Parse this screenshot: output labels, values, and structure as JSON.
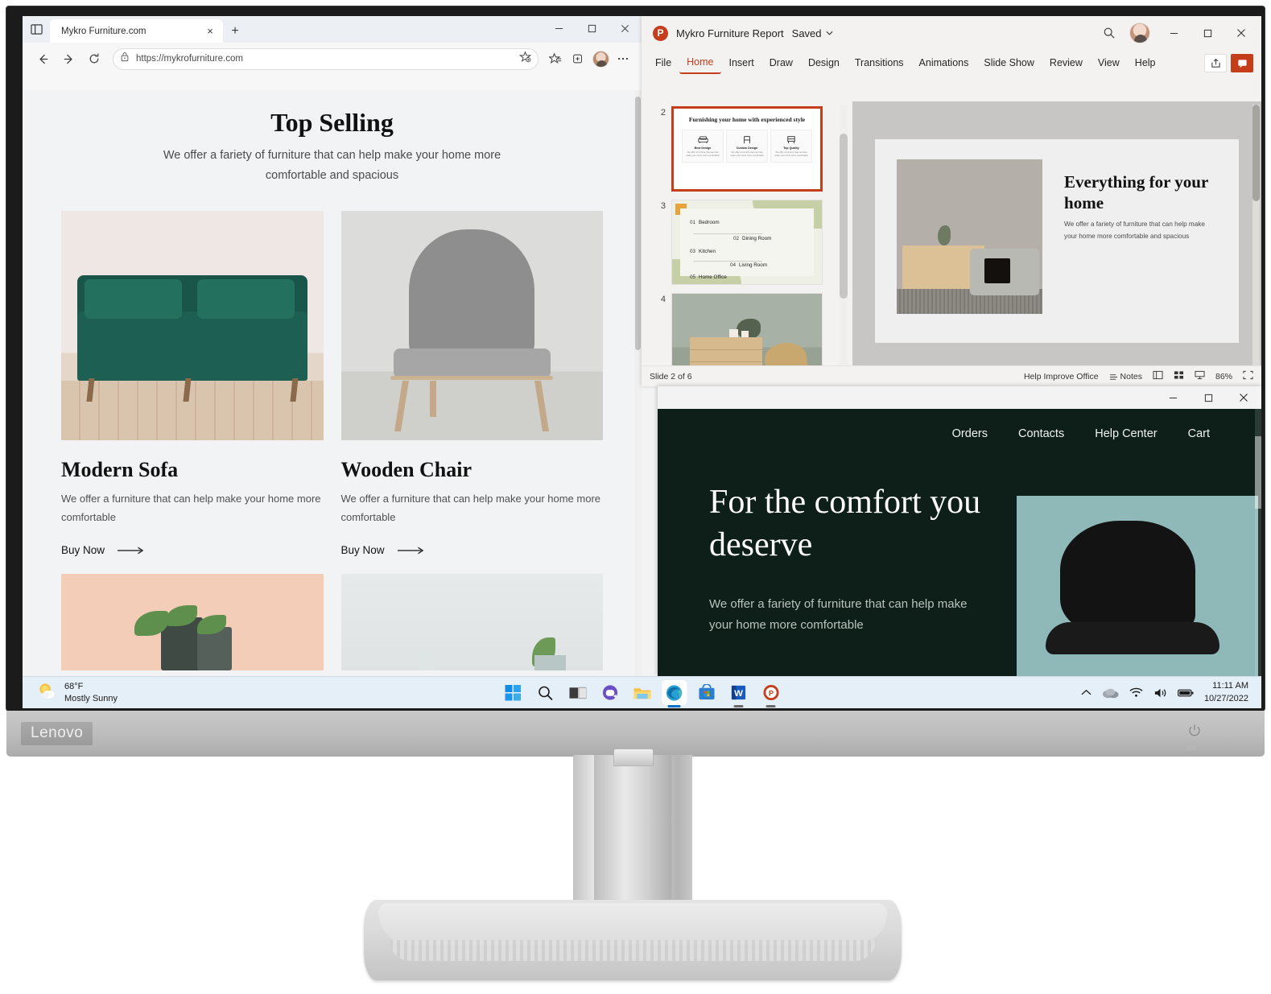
{
  "browser": {
    "tab": {
      "title": "Mykro Furniture.com",
      "close_label": "×"
    },
    "new_tab_label": "+",
    "url": "https://mykrofurniture.com",
    "window_controls": {
      "minimize": "—",
      "maximize": "□",
      "close": "✕"
    },
    "page": {
      "heading": "Top Selling",
      "subheading": "We offer a fariety of furniture that can help make your home more comfortable and spacious",
      "products": [
        {
          "name": "Modern Sofa",
          "description": "We offer a furniture that can help make your home more comfortable",
          "cta": "Buy Now"
        },
        {
          "name": "Wooden Chair",
          "description": "We offer a furniture that can help make your home more comfortable",
          "cta": "Buy Now"
        }
      ]
    }
  },
  "powerpoint": {
    "document_title": "Mykro Furniture Report",
    "save_status": "Saved",
    "ribbon_tabs": [
      "File",
      "Home",
      "Insert",
      "Draw",
      "Design",
      "Transitions",
      "Animations",
      "Slide Show",
      "Review",
      "View",
      "Help"
    ],
    "active_tab": "Home",
    "window_controls": {
      "minimize": "—",
      "maximize": "□",
      "close": "✕"
    },
    "slides": [
      {
        "number": "2",
        "selected": true,
        "title": "Furnishing your home with experienced style",
        "cards": [
          {
            "label": "Best Design",
            "body": "We offer a furniture that can help make your home more comfortable"
          },
          {
            "label": "Custom Design",
            "body": "We offer a furniture that can help make your home more comfortable"
          },
          {
            "label": "Top Quality",
            "body": "We offer a furniture that can help make your home more comfortable"
          }
        ]
      },
      {
        "number": "3",
        "selected": false,
        "items": [
          {
            "num": "01",
            "label": "Bedroom"
          },
          {
            "num": "02",
            "label": "Dining Room"
          },
          {
            "num": "03",
            "label": "Kitchen"
          },
          {
            "num": "04",
            "label": "Living Room"
          },
          {
            "num": "05",
            "label": "Home Office"
          }
        ]
      },
      {
        "number": "4",
        "selected": false
      }
    ],
    "current_slide": {
      "heading": "Everything for your home",
      "body": "We offer a fariety of furniture that can help make your home more comfortable and spacious"
    },
    "status": {
      "slide_counter": "Slide 2 of 6",
      "help_improve": "Help Improve Office",
      "notes": "Notes",
      "zoom": "86%"
    }
  },
  "site_window": {
    "window_controls": {
      "minimize": "—",
      "maximize": "□",
      "close": "✕"
    },
    "nav": [
      "Orders",
      "Contacts",
      "Help Center",
      "Cart"
    ],
    "hero_heading": "For the comfort you deserve",
    "hero_body": "We offer a fariety of furniture that can help make your home more comfortable"
  },
  "taskbar": {
    "weather": {
      "temperature": "68°F",
      "condition": "Mostly Sunny"
    },
    "apps": [
      "start",
      "search",
      "task-view",
      "teams",
      "file-explorer",
      "edge",
      "microsoft-store",
      "word",
      "powerpoint"
    ],
    "clock": {
      "time": "11:11 AM",
      "date": "10/27/2022"
    }
  },
  "monitor": {
    "brand": "Lenovo"
  }
}
